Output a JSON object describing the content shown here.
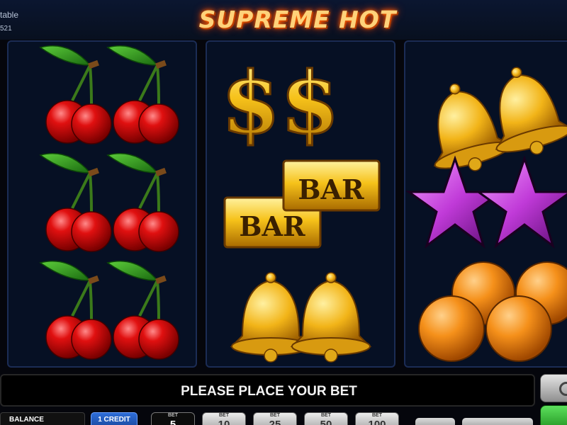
{
  "header": {
    "paytable_label": "table",
    "small_number": "521",
    "game_title": "SUPREME HOT"
  },
  "reels": [
    {
      "symbols": [
        "cherries",
        "cherries",
        "cherries"
      ]
    },
    {
      "symbols": [
        "dollar",
        "bar",
        "bell"
      ]
    },
    {
      "symbols": [
        "bell",
        "star",
        "orange"
      ]
    }
  ],
  "bar_symbol_text": "BAR",
  "message": "PLEASE PLACE YOUR BET",
  "controls": {
    "balance_label": "BALANCE",
    "credit_label": "1 CREDIT",
    "bet_label": "BET",
    "bets": [
      "5",
      "10",
      "25",
      "50",
      "100"
    ],
    "selected_bet": "5"
  },
  "colors": {
    "reel_background": "#061024",
    "message_text": "#f2f2f2",
    "credit_button": "#2d6dd8",
    "spin_button": "#3ac43a",
    "cherry_red": "#e01010",
    "gold": "#f6c21a",
    "star_purple": "#c03ad8",
    "orange_fruit": "#f5901a"
  }
}
